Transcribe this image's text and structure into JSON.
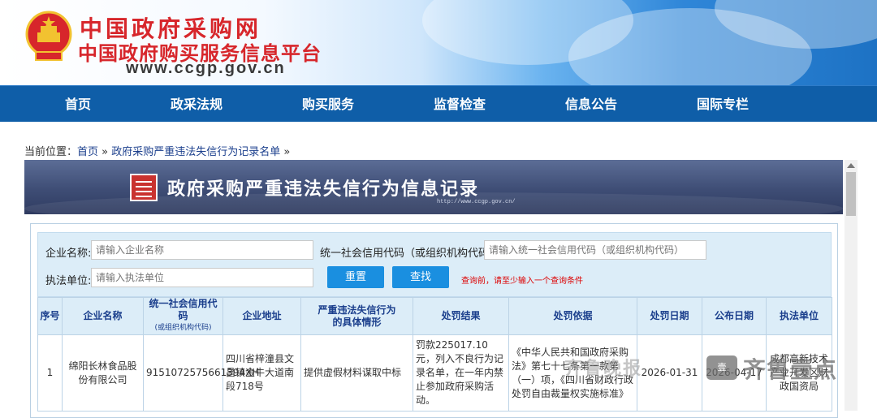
{
  "header": {
    "site_name": "中国政府采购网",
    "site_subtitle": "中国政府购买服务信息平台",
    "site_url": "www.ccgp.gov.cn"
  },
  "nav": {
    "items": [
      "首页",
      "政采法规",
      "购买服务",
      "监督检查",
      "信息公告",
      "国际专栏"
    ]
  },
  "breadcrumb": {
    "prefix": "当前位置：",
    "home": "首页",
    "separator": " » ",
    "current": "政府采购严重违法失信行为记录名单",
    "trail": " »"
  },
  "banner": {
    "title": "政府采购严重违法失信行为信息记录",
    "url": "http://www.ccgp.gov.cn/"
  },
  "search": {
    "company_label": "企业名称:",
    "company_placeholder": "请输入企业名称",
    "credit_label": "统一社会信用代码（或组织机构代码）:",
    "credit_placeholder": "请输入统一社会信用代码（或组织机构代码）",
    "agency_label": "执法单位:",
    "agency_placeholder": "请输入执法单位",
    "reset_label": "重置",
    "search_label": "查找",
    "tip": "查询前，请至少输入一个查询条件"
  },
  "table": {
    "headers": {
      "index": "序号",
      "company": "企业名称",
      "credit_code": "统一社会信用代码",
      "credit_code_sub": "(或组织机构代码)",
      "address": "企业地址",
      "situation_1": "严重违法失信行为",
      "situation_2": "的具体情形",
      "result": "处罚结果",
      "basis": "处罚依据",
      "penalty_date": "处罚日期",
      "publish_date": "公布日期",
      "agency": "执法单位"
    },
    "rows": [
      {
        "index": "1",
        "company": "绵阳长林食品股份有限公司",
        "credit_code": "9151072575661394XH",
        "address": "四川省梓潼县文昌镇金牛大道南段718号",
        "situation": "提供虚假材料谋取中标",
        "result": "罚款225017.10元，列入不良行为记录名单，在一年内禁止参加政府采购活动。",
        "basis": "《中华人民共和国政府采购法》第七十七条第一款第（一）项，《四川省财政行政处罚自由裁量权实施标准》",
        "penalty_date": "2026-01-31",
        "publish_date": "2026-04-17",
        "agency": "成都高新技术产业开发区财政国资局"
      }
    ]
  },
  "watermark": {
    "left": "齐鲁晚报",
    "box": "壹",
    "right": "齐鲁壹点"
  },
  "colors": {
    "nav_bg": "#0f5ea8",
    "site_name": "#d7262b",
    "link": "#1a3e8c",
    "button": "#1a8fe0",
    "tip": "#dd0000",
    "search_bg": "#dcedf8"
  }
}
